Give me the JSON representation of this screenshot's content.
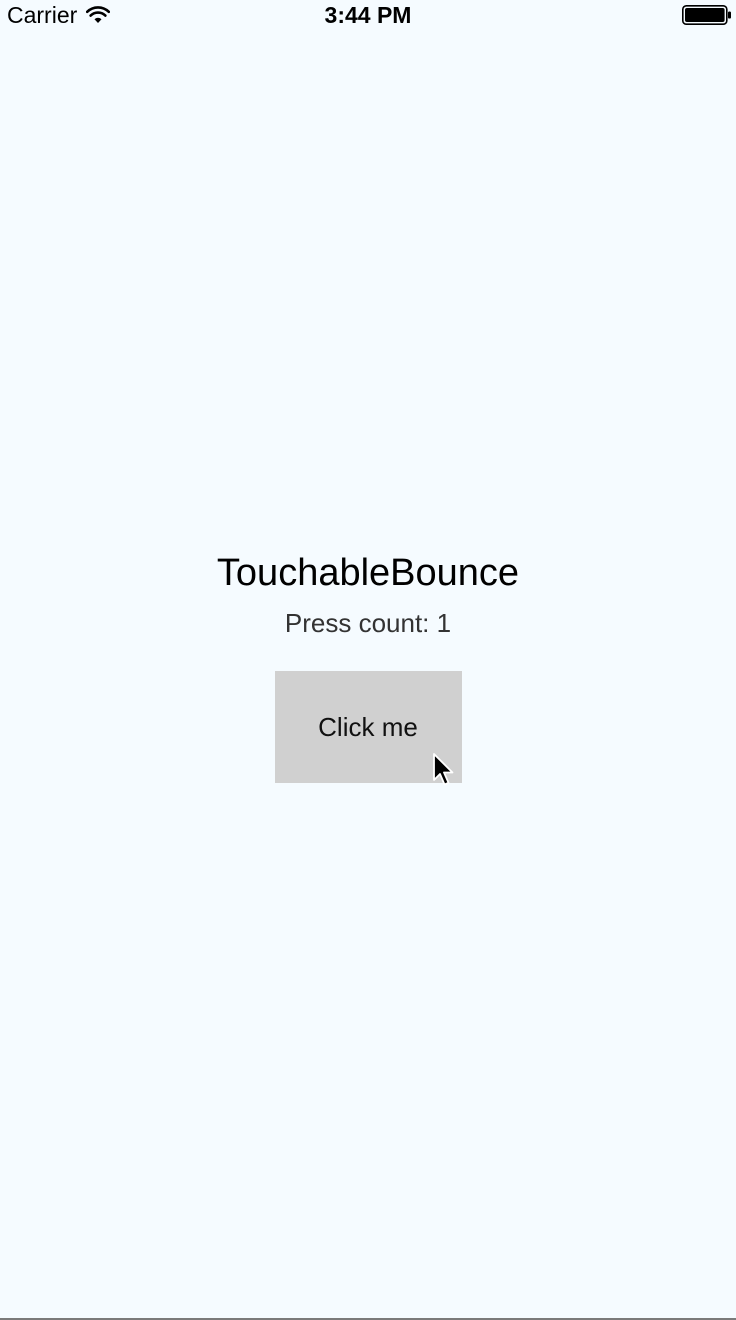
{
  "status_bar": {
    "carrier": "Carrier",
    "time": "3:44 PM",
    "wifi_icon": "wifi-icon",
    "battery_icon": "battery-icon"
  },
  "main": {
    "title": "TouchableBounce",
    "press_count": "Press count: 1",
    "button_label": "Click me"
  },
  "colors": {
    "background": "#f5fbff",
    "button_bg": "#d0d0d0"
  }
}
